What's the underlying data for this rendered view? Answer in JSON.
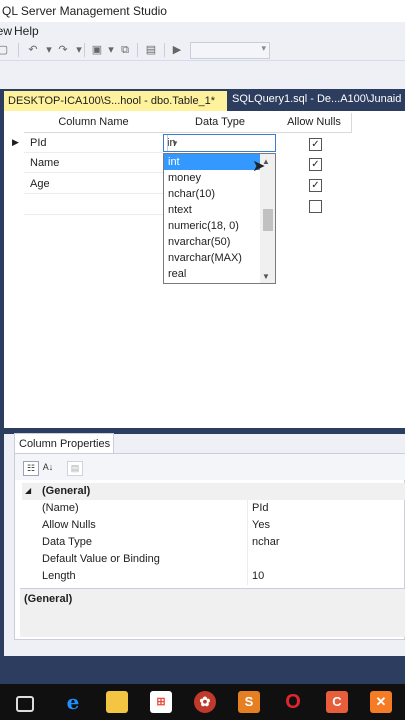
{
  "window": {
    "title": "QL Server Management Studio"
  },
  "menu": {
    "items": [
      "iew",
      "Help"
    ]
  },
  "tabs": [
    {
      "label": "DESKTOP-ICA100\\S...hool - dbo.Table_1*",
      "active": true
    },
    {
      "label": "SQLQuery1.sql - De...A100\\Junaid (",
      "active": false
    }
  ],
  "grid": {
    "headers": {
      "column_name": "Column Name",
      "data_type": "Data Type",
      "allow_nulls": "Allow Nulls"
    },
    "rows": [
      {
        "name": "PId",
        "data_type": "in",
        "allow_nulls": true,
        "current": true
      },
      {
        "name": "Name",
        "data_type": "",
        "allow_nulls": true,
        "current": false
      },
      {
        "name": "Age",
        "data_type": "",
        "allow_nulls": true,
        "current": false
      },
      {
        "name": "",
        "data_type": "",
        "allow_nulls": false,
        "current": false
      }
    ]
  },
  "dropdown": {
    "selected": "int",
    "options": [
      "int",
      "money",
      "nchar(10)",
      "ntext",
      "numeric(18, 0)",
      "nvarchar(50)",
      "nvarchar(MAX)",
      "real"
    ]
  },
  "column_properties": {
    "title": "Column Properties",
    "group": "(General)",
    "props": [
      {
        "name": "(Name)",
        "value": "PId"
      },
      {
        "name": "Allow Nulls",
        "value": "Yes"
      },
      {
        "name": "Data Type",
        "value": "nchar"
      },
      {
        "name": "Default Value or Binding",
        "value": ""
      },
      {
        "name": "Length",
        "value": "10"
      }
    ],
    "description": "(General)"
  },
  "icons": {
    "row_indicator": "current-row-arrow-icon",
    "cursor": "mouse-pointer-icon"
  },
  "colors": {
    "tab_active_bg": "#fff29d",
    "chrome_dark": "#2d3d5f",
    "selection": "#3399ff"
  }
}
